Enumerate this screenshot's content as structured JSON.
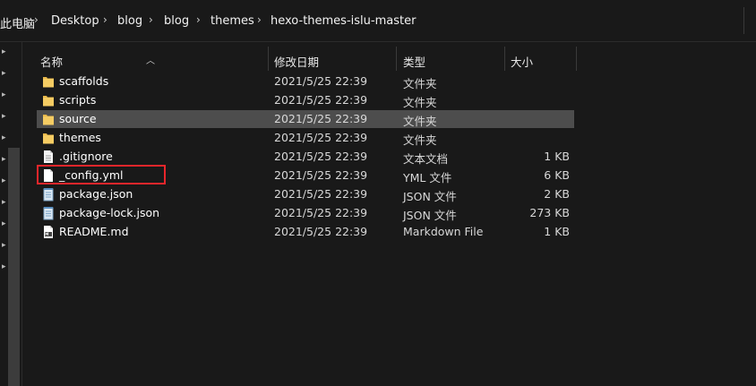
{
  "breadcrumb": {
    "items": [
      "此电脑",
      "Desktop",
      "blog",
      "blog",
      "themes",
      "hexo-themes-islu-master"
    ],
    "separator": "›"
  },
  "columns": {
    "name": "名称",
    "date": "修改日期",
    "type": "类型",
    "size": "大小"
  },
  "files": [
    {
      "name": "scaffolds",
      "date": "2021/5/25 22:39",
      "type": "文件夹",
      "size": "",
      "icon": "folder-icon"
    },
    {
      "name": "scripts",
      "date": "2021/5/25 22:39",
      "type": "文件夹",
      "size": "",
      "icon": "folder-icon"
    },
    {
      "name": "source",
      "date": "2021/5/25 22:39",
      "type": "文件夹",
      "size": "",
      "icon": "folder-icon",
      "selected": true
    },
    {
      "name": "themes",
      "date": "2021/5/25 22:39",
      "type": "文件夹",
      "size": "",
      "icon": "folder-icon"
    },
    {
      "name": ".gitignore",
      "date": "2021/5/25 22:39",
      "type": "文本文档",
      "size": "1 KB",
      "icon": "text-file-icon"
    },
    {
      "name": "_config.yml",
      "date": "2021/5/25 22:39",
      "type": "YML 文件",
      "size": "6 KB",
      "icon": "file-icon",
      "highlighted": true
    },
    {
      "name": "package.json",
      "date": "2021/5/25 22:39",
      "type": "JSON 文件",
      "size": "2 KB",
      "icon": "notepad-file-icon"
    },
    {
      "name": "package-lock.json",
      "date": "2021/5/25 22:39",
      "type": "JSON 文件",
      "size": "273 KB",
      "icon": "notepad-file-icon"
    },
    {
      "name": "README.md",
      "date": "2021/5/25 22:39",
      "type": "Markdown File",
      "size": "1 KB",
      "icon": "markdown-file-icon"
    }
  ],
  "colors": {
    "background": "#191919",
    "selected_row": "#4d4d4d",
    "highlight_border": "#e8262b",
    "folder": "#e8b84a"
  }
}
